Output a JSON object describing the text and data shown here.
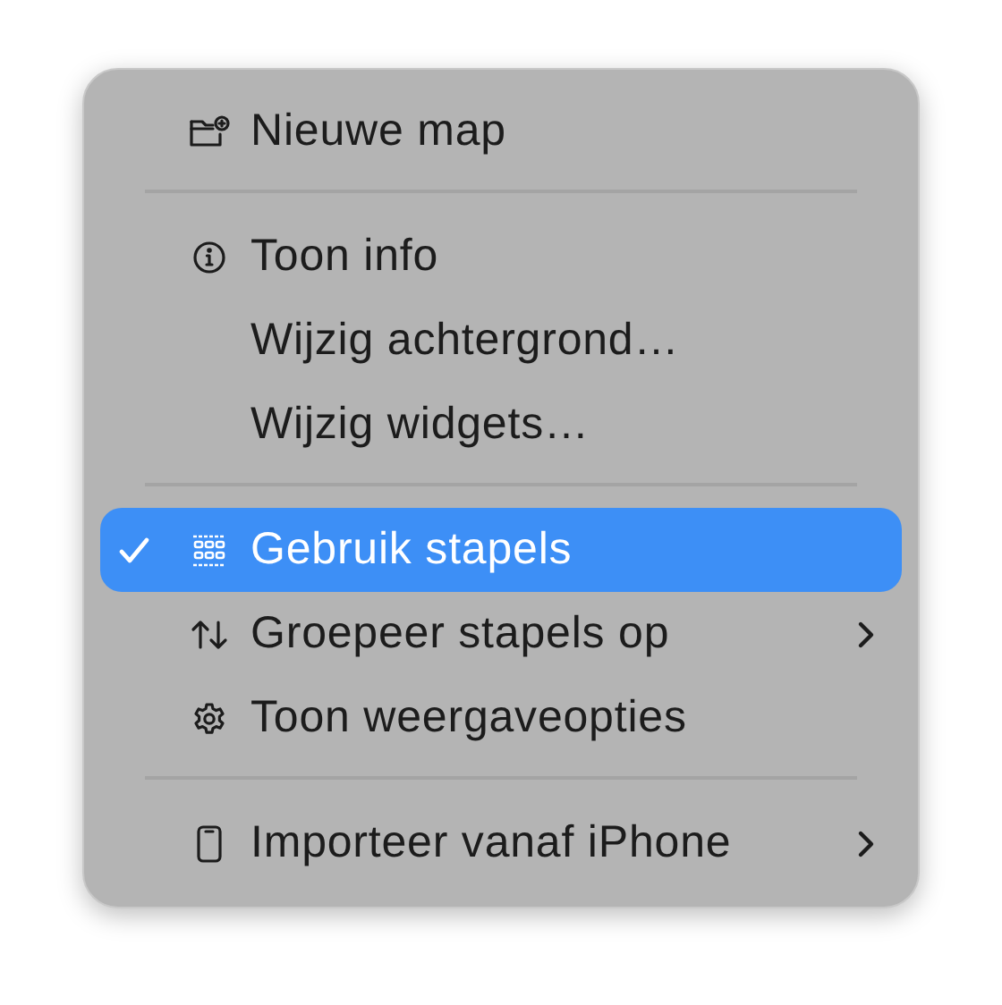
{
  "menu": {
    "entries": [
      {
        "kind": "item",
        "label": "Nieuwe map",
        "checked": false,
        "selected": false,
        "submenu": false
      },
      {
        "kind": "separator"
      },
      {
        "kind": "item",
        "label": "Toon info",
        "checked": false,
        "selected": false,
        "submenu": false
      },
      {
        "kind": "item",
        "label": "Wijzig achtergrond…",
        "checked": false,
        "selected": false,
        "submenu": false
      },
      {
        "kind": "item",
        "label": "Wijzig widgets…",
        "checked": false,
        "selected": false,
        "submenu": false
      },
      {
        "kind": "separator"
      },
      {
        "kind": "item",
        "label": "Gebruik stapels",
        "checked": true,
        "selected": true,
        "submenu": false
      },
      {
        "kind": "item",
        "label": "Groepeer stapels op",
        "checked": false,
        "selected": false,
        "submenu": true
      },
      {
        "kind": "item",
        "label": "Toon weergaveopties",
        "checked": false,
        "selected": false,
        "submenu": false
      },
      {
        "kind": "separator"
      },
      {
        "kind": "item",
        "label": "Importeer vanaf iPhone",
        "checked": false,
        "selected": false,
        "submenu": true
      }
    ]
  }
}
